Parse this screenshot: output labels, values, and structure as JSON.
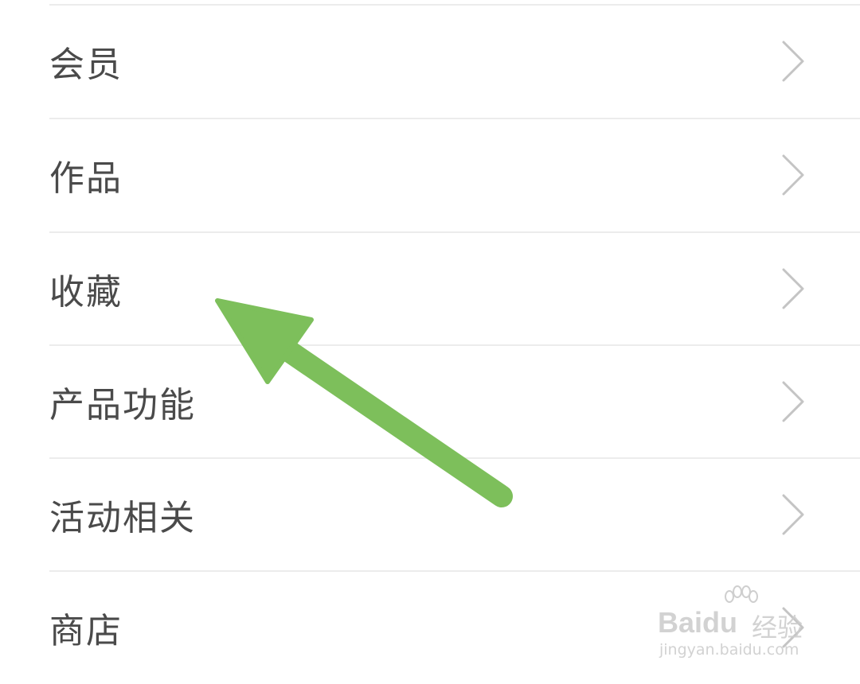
{
  "menu": {
    "items": [
      {
        "label": "会员"
      },
      {
        "label": "作品"
      },
      {
        "label": "收藏"
      },
      {
        "label": "产品功能"
      },
      {
        "label": "活动相关"
      },
      {
        "label": "商店"
      }
    ]
  },
  "annotation": {
    "arrow_color": "#7dbf5b"
  },
  "watermark": {
    "brand": "Baidu",
    "brand_cn": "经验",
    "url": "jingyan.baidu.com"
  },
  "colors": {
    "text": "#4a4a4a",
    "divider": "#ececec",
    "chevron": "#c4c4c4",
    "background": "#ffffff"
  }
}
